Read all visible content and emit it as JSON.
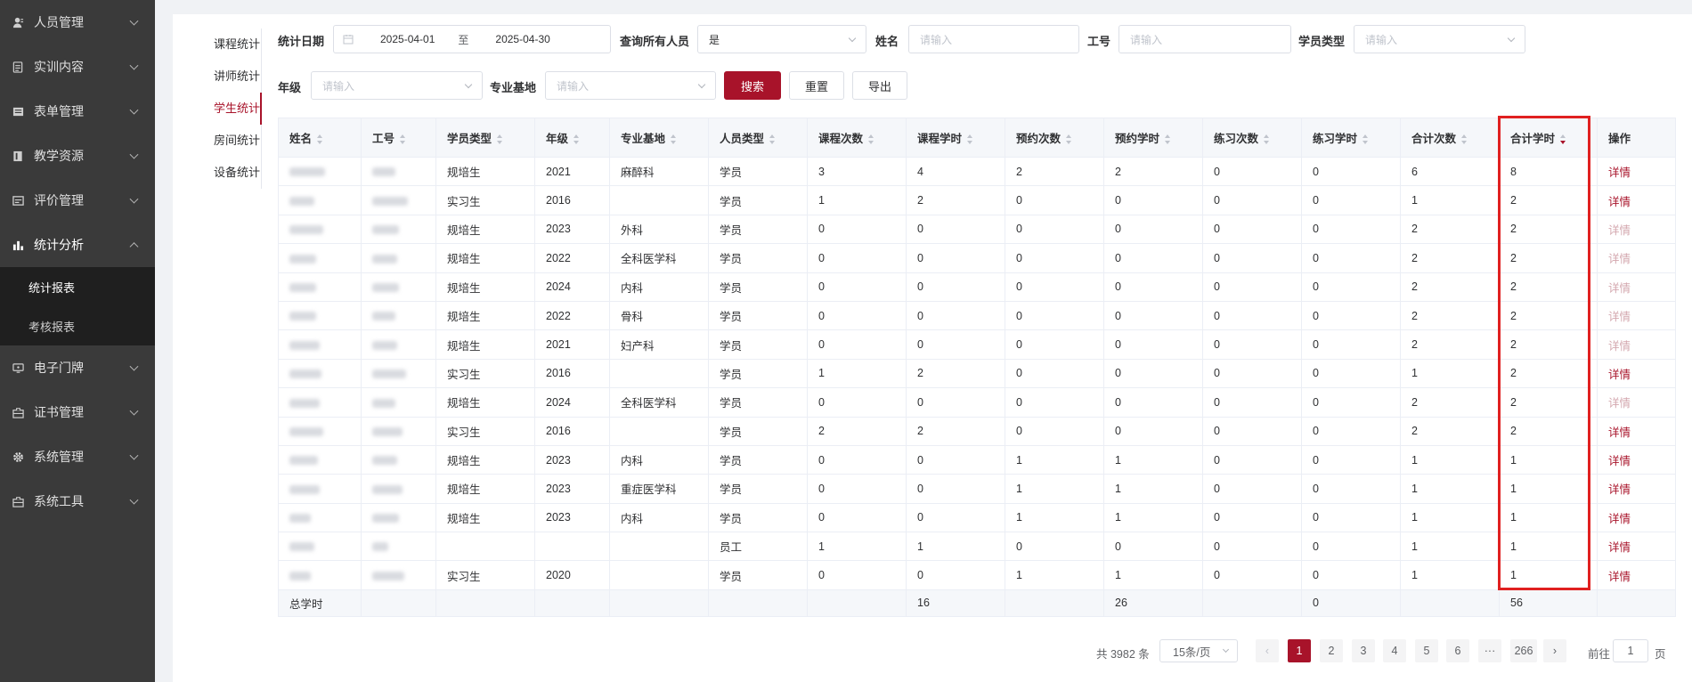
{
  "sidebar": {
    "items": [
      {
        "label": "人员管理",
        "icon": "person-icon"
      },
      {
        "label": "实训内容",
        "icon": "document-icon"
      },
      {
        "label": "表单管理",
        "icon": "form-icon"
      },
      {
        "label": "教学资源",
        "icon": "book-icon"
      },
      {
        "label": "评价管理",
        "icon": "evaluation-icon"
      },
      {
        "label": "统计分析",
        "icon": "bar-chart-icon"
      },
      {
        "label": "电子门牌",
        "icon": "monitor-icon"
      },
      {
        "label": "证书管理",
        "icon": "certificate-icon"
      },
      {
        "label": "系统管理",
        "icon": "gear-icon"
      },
      {
        "label": "系统工具",
        "icon": "toolbox-icon"
      }
    ],
    "submenu": [
      "统计报表",
      "考核报表"
    ]
  },
  "subtabs": [
    "课程统计",
    "讲师统计",
    "学生统计",
    "房间统计",
    "设备统计"
  ],
  "filters": {
    "date_label": "统计日期",
    "date_start": "2025-04-01",
    "date_sep": "至",
    "date_end": "2025-04-30",
    "query_all_label": "查询所有人员",
    "query_all_value": "是",
    "name_label": "姓名",
    "name_placeholder": "请输入",
    "id_label": "工号",
    "id_placeholder": "请输入",
    "student_type_label": "学员类型",
    "student_type_placeholder": "请输入",
    "grade_label": "年级",
    "grade_placeholder": "请输入",
    "base_label": "专业基地",
    "base_placeholder": "请输入",
    "search_btn": "搜索",
    "reset_btn": "重置",
    "export_btn": "导出"
  },
  "table": {
    "headers": [
      "姓名",
      "工号",
      "学员类型",
      "年级",
      "专业基地",
      "人员类型",
      "课程次数",
      "课程学时",
      "预约次数",
      "预约学时",
      "练习次数",
      "练习学时",
      "合计次数",
      "合计学时",
      "操作"
    ],
    "rows": [
      {
        "type": "规培生",
        "grade": "2021",
        "base": "麻醉科",
        "ptype": "学员",
        "c1": "3",
        "c2": "4",
        "c3": "2",
        "c4": "2",
        "c5": "0",
        "c6": "0",
        "c7": "6",
        "c8": "8",
        "op": "详情",
        "op_enabled": true
      },
      {
        "type": "实习生",
        "grade": "2016",
        "base": "",
        "ptype": "学员",
        "c1": "1",
        "c2": "2",
        "c3": "0",
        "c4": "0",
        "c5": "0",
        "c6": "0",
        "c7": "1",
        "c8": "2",
        "op": "详情",
        "op_enabled": true
      },
      {
        "type": "规培生",
        "grade": "2023",
        "base": "外科",
        "ptype": "学员",
        "c1": "0",
        "c2": "0",
        "c3": "0",
        "c4": "0",
        "c5": "0",
        "c6": "0",
        "c7": "2",
        "c8": "2",
        "op": "详情",
        "op_enabled": false
      },
      {
        "type": "规培生",
        "grade": "2022",
        "base": "全科医学科",
        "ptype": "学员",
        "c1": "0",
        "c2": "0",
        "c3": "0",
        "c4": "0",
        "c5": "0",
        "c6": "0",
        "c7": "2",
        "c8": "2",
        "op": "详情",
        "op_enabled": false
      },
      {
        "type": "规培生",
        "grade": "2024",
        "base": "内科",
        "ptype": "学员",
        "c1": "0",
        "c2": "0",
        "c3": "0",
        "c4": "0",
        "c5": "0",
        "c6": "0",
        "c7": "2",
        "c8": "2",
        "op": "详情",
        "op_enabled": false
      },
      {
        "type": "规培生",
        "grade": "2022",
        "base": "骨科",
        "ptype": "学员",
        "c1": "0",
        "c2": "0",
        "c3": "0",
        "c4": "0",
        "c5": "0",
        "c6": "0",
        "c7": "2",
        "c8": "2",
        "op": "详情",
        "op_enabled": false
      },
      {
        "type": "规培生",
        "grade": "2021",
        "base": "妇产科",
        "ptype": "学员",
        "c1": "0",
        "c2": "0",
        "c3": "0",
        "c4": "0",
        "c5": "0",
        "c6": "0",
        "c7": "2",
        "c8": "2",
        "op": "详情",
        "op_enabled": false
      },
      {
        "type": "实习生",
        "grade": "2016",
        "base": "",
        "ptype": "学员",
        "c1": "1",
        "c2": "2",
        "c3": "0",
        "c4": "0",
        "c5": "0",
        "c6": "0",
        "c7": "1",
        "c8": "2",
        "op": "详情",
        "op_enabled": true
      },
      {
        "type": "规培生",
        "grade": "2024",
        "base": "全科医学科",
        "ptype": "学员",
        "c1": "0",
        "c2": "0",
        "c3": "0",
        "c4": "0",
        "c5": "0",
        "c6": "0",
        "c7": "2",
        "c8": "2",
        "op": "详情",
        "op_enabled": false
      },
      {
        "type": "实习生",
        "grade": "2016",
        "base": "",
        "ptype": "学员",
        "c1": "2",
        "c2": "2",
        "c3": "0",
        "c4": "0",
        "c5": "0",
        "c6": "0",
        "c7": "2",
        "c8": "2",
        "op": "详情",
        "op_enabled": true
      },
      {
        "type": "规培生",
        "grade": "2023",
        "base": "内科",
        "ptype": "学员",
        "c1": "0",
        "c2": "0",
        "c3": "1",
        "c4": "1",
        "c5": "0",
        "c6": "0",
        "c7": "1",
        "c8": "1",
        "op": "详情",
        "op_enabled": true
      },
      {
        "type": "规培生",
        "grade": "2023",
        "base": "重症医学科",
        "ptype": "学员",
        "c1": "0",
        "c2": "0",
        "c3": "1",
        "c4": "1",
        "c5": "0",
        "c6": "0",
        "c7": "1",
        "c8": "1",
        "op": "详情",
        "op_enabled": true
      },
      {
        "type": "规培生",
        "grade": "2023",
        "base": "内科",
        "ptype": "学员",
        "c1": "0",
        "c2": "0",
        "c3": "1",
        "c4": "1",
        "c5": "0",
        "c6": "0",
        "c7": "1",
        "c8": "1",
        "op": "详情",
        "op_enabled": true
      },
      {
        "type": "",
        "grade": "",
        "base": "",
        "ptype": "员工",
        "c1": "1",
        "c2": "1",
        "c3": "0",
        "c4": "0",
        "c5": "0",
        "c6": "0",
        "c7": "1",
        "c8": "1",
        "op": "详情",
        "op_enabled": true
      },
      {
        "type": "实习生",
        "grade": "2020",
        "base": "",
        "ptype": "学员",
        "c1": "0",
        "c2": "0",
        "c3": "1",
        "c4": "1",
        "c5": "0",
        "c6": "0",
        "c7": "1",
        "c8": "1",
        "op": "详情",
        "op_enabled": true
      }
    ],
    "footer": {
      "label": "总学时",
      "course_hours": "16",
      "booking_hours": "26",
      "practice_hours": "0",
      "total_hours": "56"
    }
  },
  "pagination": {
    "total": "共 3982 条",
    "page_size": "15条/页",
    "pages": [
      "1",
      "2",
      "3",
      "4",
      "5",
      "6",
      "···",
      "266"
    ],
    "current": "1",
    "goto_label": "前往",
    "goto_value": "1",
    "page_suffix": "页"
  },
  "colors": {
    "accent": "#a8132a",
    "sidebar_bg": "#3a3a3a",
    "highlight": "#e02020"
  }
}
